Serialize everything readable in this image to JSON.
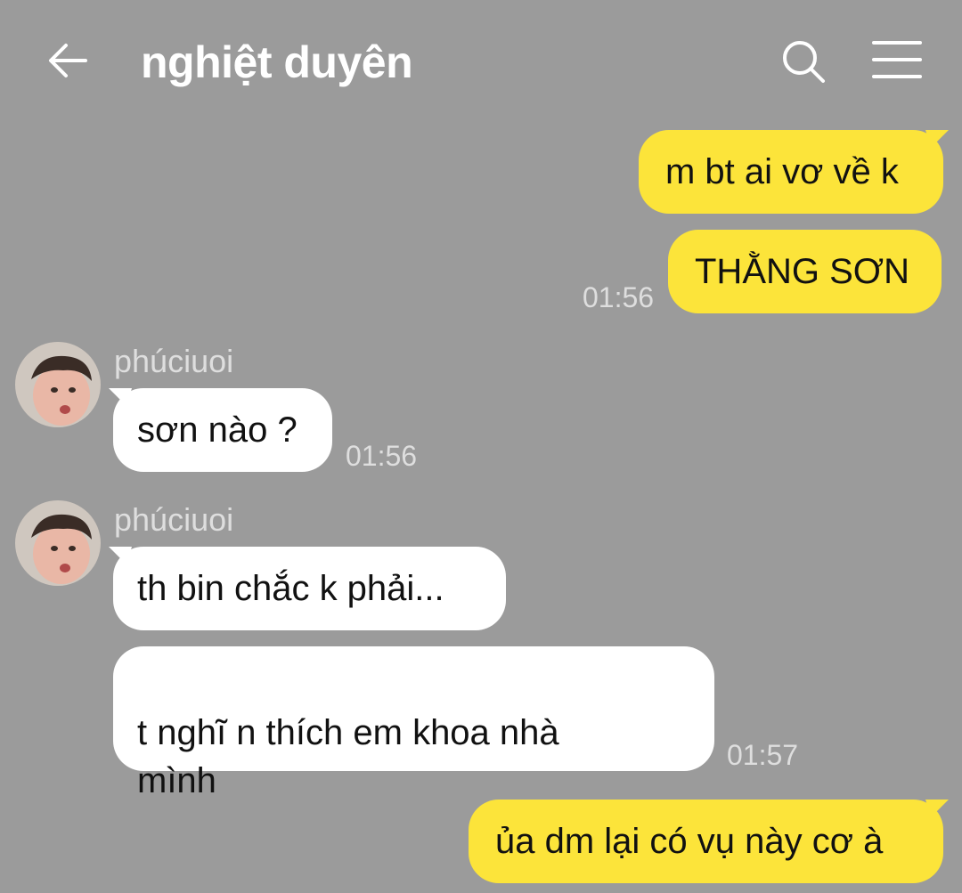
{
  "header": {
    "title": "nghiệt duyên",
    "back_icon": "arrow-left-icon",
    "search_icon": "search-icon",
    "menu_icon": "hamburger-menu-icon"
  },
  "colors": {
    "background": "#9b9b9b",
    "outgoing_bubble": "#fce43a",
    "incoming_bubble": "#ffffff",
    "meta_text": "#dedede"
  },
  "messages": [
    {
      "direction": "outgoing",
      "text": "m bt ai vơ về k"
    },
    {
      "direction": "outgoing",
      "text": "THẰNG SƠN",
      "time": "01:56"
    },
    {
      "direction": "incoming",
      "sender": "phúciuoi",
      "text": "sơn nào ?",
      "time": "01:56"
    },
    {
      "direction": "incoming",
      "sender": "phúciuoi",
      "text": "th bin chắc k phải..."
    },
    {
      "direction": "incoming",
      "text": "t nghĩ n thích em khoa nhà\nmình",
      "time": "01:57"
    },
    {
      "direction": "outgoing",
      "text": "ủa dm lại có vụ này cơ à"
    }
  ]
}
